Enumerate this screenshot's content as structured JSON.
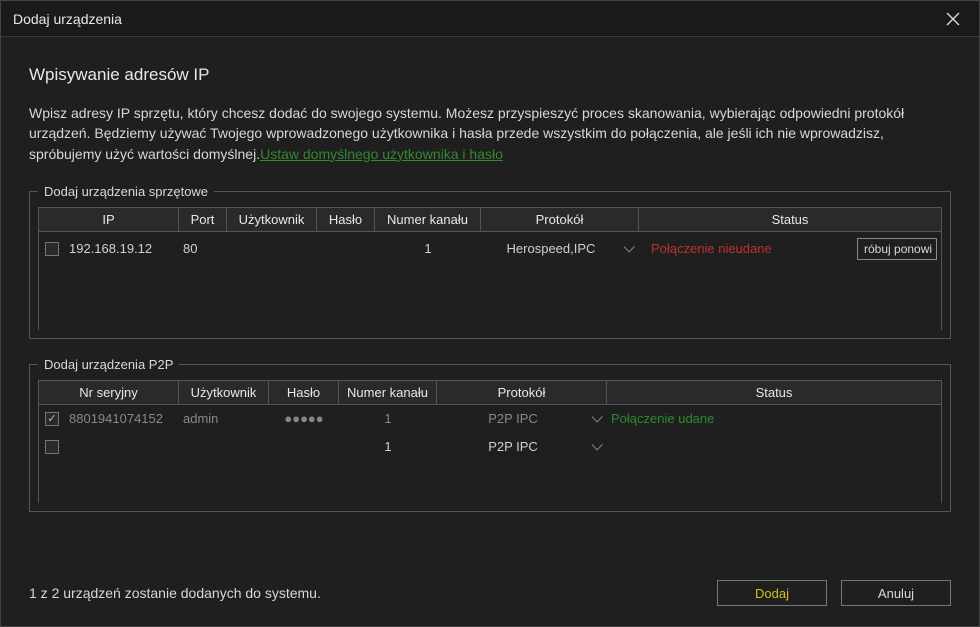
{
  "title": "Dodaj urządzenia",
  "heading": "Wpisywanie adresów IP",
  "description_part1": "Wpisz adresy IP sprzętu, który chcesz dodać do swojego systemu. Możesz przyspieszyć proces skanowania, wybierając odpowiedni protokół urządzeń. Będziemy używać Twojego wprowadzonego użytkownika i hasła przede wszystkim do połączenia, ale jeśli ich nie wprowadzisz, spróbujemy użyć wartości domyślnej.",
  "link_text": "Ustaw domyślnego użytkownika i hasło",
  "hw_group_label": "Dodaj urządzenia sprzętowe",
  "hw_headers": {
    "ip": "IP",
    "port": "Port",
    "user": "Użytkownik",
    "password": "Hasło",
    "channel": "Numer kanału",
    "protocol": "Protokół",
    "status": "Status"
  },
  "hw_rows": [
    {
      "checked": false,
      "ip": "192.168.19.12",
      "port": "80",
      "user": "",
      "password": "",
      "channel": "1",
      "protocol": "Herospeed,IPC",
      "status": "Połączenie nieudane",
      "status_class": "fail",
      "retry": "róbuj ponowi"
    }
  ],
  "p2p_group_label": "Dodaj urządzenia P2P",
  "p2p_headers": {
    "serial": "Nr seryjny",
    "user": "Użytkownik",
    "password": "Hasło",
    "channel": "Numer kanału",
    "protocol": "Protokół",
    "status": "Status"
  },
  "p2p_rows": [
    {
      "checked": true,
      "dim": true,
      "serial": "8801941074152",
      "user": "admin",
      "password": "●●●●●",
      "channel": "1",
      "protocol": "P2P IPC",
      "status": "Połączenie udane",
      "status_class": "ok"
    },
    {
      "checked": false,
      "dim": false,
      "serial": "",
      "user": "",
      "password": "",
      "channel": "1",
      "protocol": "P2P IPC",
      "status": "",
      "status_class": ""
    }
  ],
  "footer_status": "1 z 2 urządzeń zostanie dodanych do systemu.",
  "buttons": {
    "add": "Dodaj",
    "cancel": "Anuluj"
  }
}
